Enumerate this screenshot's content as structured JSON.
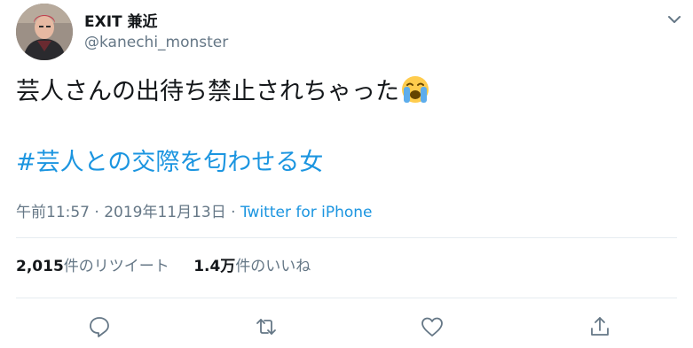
{
  "user": {
    "display_name": "EXIT 兼近",
    "handle": "@kanechi_monster",
    "avatar_icon": "avatar-icon"
  },
  "tweet": {
    "text": "芸人さんの出待ち禁止されちゃった",
    "emoji_icon": "crying-face-icon",
    "hashtag": "#芸人との交際を匂わせる女",
    "time": "午前11:57",
    "separator": "·",
    "date": "2019年11月13日",
    "source": "Twitter for iPhone"
  },
  "stats": {
    "retweets_count": "2,015",
    "retweets_label": "件のリツイート",
    "likes_count": "1.4万",
    "likes_label": "件のいいね"
  },
  "actions": [
    {
      "icon": "reply-icon"
    },
    {
      "icon": "retweet-icon"
    },
    {
      "icon": "like-icon"
    },
    {
      "icon": "share-icon"
    }
  ],
  "colors": {
    "text": "#14171a",
    "secondary": "#657786",
    "link": "#1b95e0",
    "divider": "#e6ecf0"
  }
}
